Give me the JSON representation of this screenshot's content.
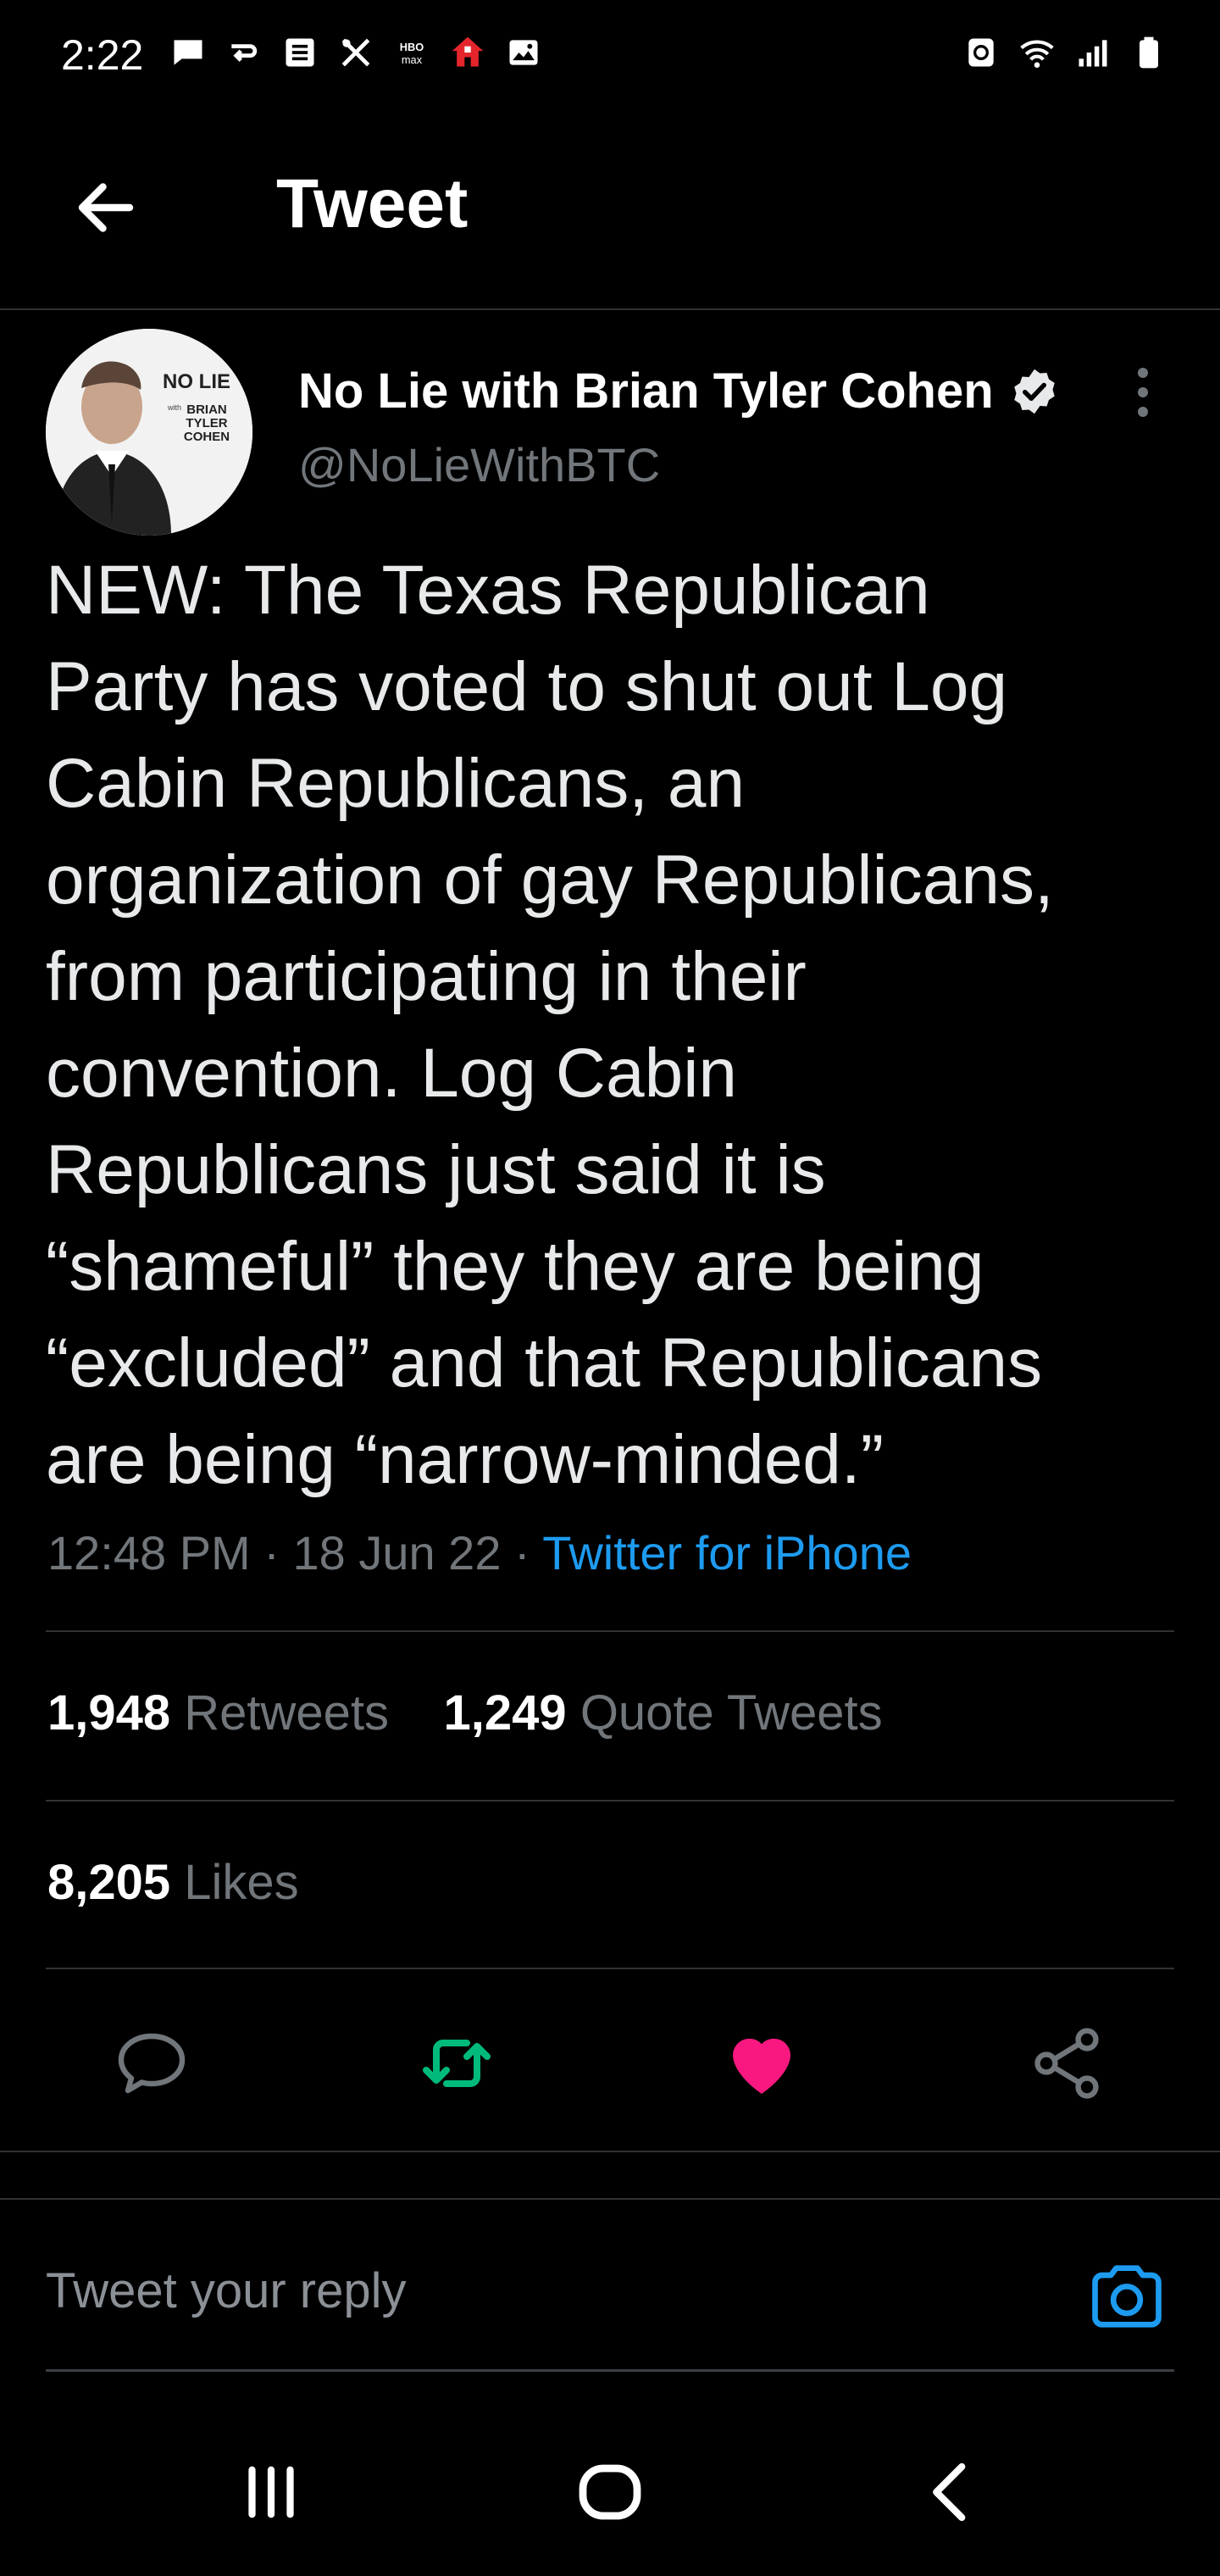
{
  "status_bar": {
    "time": "2:22",
    "left_icons": [
      "message-icon",
      "arrow-icon",
      "note-icon",
      "tools-icon",
      "hbo-max-icon",
      "home-icon",
      "image-icon"
    ],
    "right_icons": [
      "recycle-icon",
      "wifi-icon",
      "signal-icon",
      "battery-icon"
    ],
    "hbo_max_text": "max"
  },
  "header": {
    "title": "Tweet",
    "back_icon": "back-arrow-icon"
  },
  "tweet": {
    "author_name": "No Lie with Brian Tyler Cohen",
    "author_handle": "@NoLieWithBTC",
    "verified": true,
    "avatar_logo": {
      "line1": "NO LIE",
      "line2": "with",
      "line3": "BRIAN",
      "line4": "TYLER",
      "line5": "COHEN"
    },
    "text": "NEW: The Texas Republican\nParty has voted to shut out Log\nCabin Republicans, an\norganization of gay Republicans,\nfrom participating in their\nconvention. Log Cabin\nRepublicans just said it is\n“shameful” they they are being\n“excluded” and that Republicans\nare being “narrow-minded.”",
    "time": "12:48 PM",
    "date": "18 Jun 22",
    "separator": "·",
    "source": "Twitter for iPhone",
    "retweets": "1,948",
    "retweets_label": "Retweets",
    "quote_tweets": "1,249",
    "quote_tweets_label": "Quote Tweets",
    "likes": "8,205",
    "likes_label": "Likes"
  },
  "actions": {
    "reply_icon": "comment-icon",
    "retweet_icon": "retweet-icon",
    "like_icon": "heart-icon",
    "share_icon": "share-icon",
    "retweet_color": "#00ba7c",
    "like_color": "#f91880"
  },
  "reply_bar": {
    "placeholder": "Tweet your reply",
    "camera_icon": "camera-icon",
    "accent": "#1d9bf0"
  },
  "nav_bar": {
    "recents_icon": "recents-icon",
    "home_icon": "home-button-icon",
    "back_icon": "nav-back-icon"
  }
}
